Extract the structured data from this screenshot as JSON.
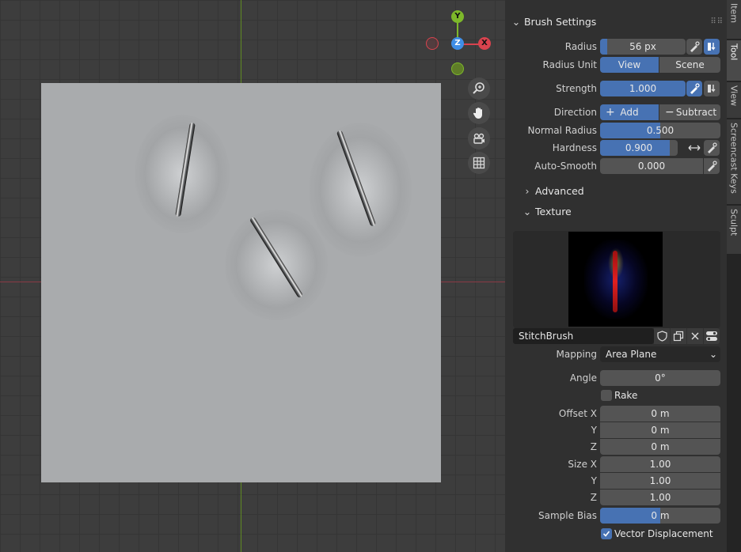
{
  "viewport": {
    "gizmo": {
      "x": "X",
      "y": "Y",
      "z": "Z"
    },
    "nav_icons": [
      "zoom-icon",
      "pan-hand-icon",
      "camera-icon",
      "grid-icon"
    ]
  },
  "sidebar": {
    "brush_settings": {
      "title": "Brush Settings",
      "radius_label": "Radius",
      "radius_value": "56 px",
      "radius_unit_label": "Radius Unit",
      "radius_unit_options": [
        "View",
        "Scene"
      ],
      "radius_unit_selected": "View",
      "strength_label": "Strength",
      "strength_value": "1.000",
      "direction_label": "Direction",
      "direction_add": "Add",
      "direction_subtract": "Subtract",
      "direction_selected": "Add",
      "normal_radius_label": "Normal Radius",
      "normal_radius_value": "0.500",
      "normal_radius_fraction": 0.5,
      "hardness_label": "Hardness",
      "hardness_value": "0.900",
      "hardness_fraction": 0.9,
      "auto_smooth_label": "Auto-Smooth",
      "auto_smooth_value": "0.000"
    },
    "advanced": {
      "title": "Advanced",
      "expanded": false
    },
    "texture": {
      "title": "Texture",
      "name": "StitchBrush",
      "mapping_label": "Mapping",
      "mapping_value": "Area Plane",
      "angle_label": "Angle",
      "angle_value": "0°",
      "rake_label": "Rake",
      "rake_checked": false,
      "offset_label": "Offset X",
      "offset_y_label": "Y",
      "offset_z_label": "Z",
      "offset_values": [
        "0 m",
        "0 m",
        "0 m"
      ],
      "size_label": "Size X",
      "size_y_label": "Y",
      "size_z_label": "Z",
      "size_values": [
        "1.00",
        "1.00",
        "1.00"
      ],
      "sample_bias_label": "Sample Bias",
      "sample_bias_value": "0 m",
      "vector_displacement_label": "Vector Displacement",
      "vector_displacement_checked": true
    }
  },
  "tabs": [
    "Item",
    "Tool",
    "View",
    "Screencast Keys",
    "Sculpt"
  ],
  "colors": {
    "accent": "#4772b3",
    "field": "#545454",
    "panel": "#303030",
    "axis_x": "#d8434e",
    "axis_y": "#7db82a",
    "axis_z": "#3f8ee6"
  }
}
